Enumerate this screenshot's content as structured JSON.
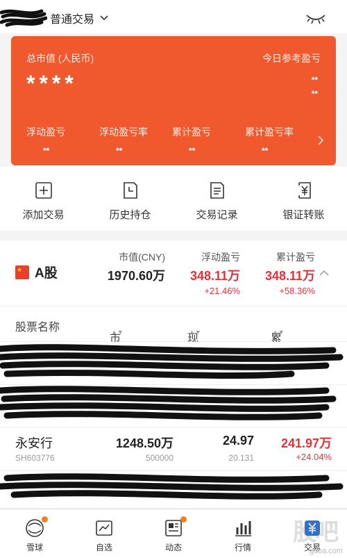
{
  "header": {
    "account_type": "普通交易"
  },
  "summary_card": {
    "total_label": "总市值 (人民币)",
    "total_value": "****",
    "today_label": "今日参考盈亏",
    "today_value_1": "**",
    "today_value_2": "**",
    "metrics": [
      {
        "label": "浮动盈亏",
        "value": "**"
      },
      {
        "label": "浮动盈亏率",
        "value": "**"
      },
      {
        "label": "累计盈亏",
        "value": "**"
      },
      {
        "label": "累计盈亏率",
        "value": "**"
      }
    ],
    "color": "#f0592d"
  },
  "quick_actions": [
    {
      "label": "添加交易",
      "icon": "plus-square-icon"
    },
    {
      "label": "历史持仓",
      "icon": "history-doc-icon"
    },
    {
      "label": "交易记录",
      "icon": "record-list-icon"
    },
    {
      "label": "银证转账",
      "icon": "yuan-transfer-icon"
    }
  ],
  "holdings_header": {
    "market": "A股",
    "market_value_label": "市值(CNY)",
    "market_value": "1970.60万",
    "float_pl_label": "浮动盈亏",
    "float_pl": "348.11万",
    "float_pl_pct": "+21.46%",
    "cum_pl_label": "累计盈亏",
    "cum_pl": "348.11万",
    "cum_pl_pct": "+58.36%"
  },
  "columns": {
    "name": "股票名称",
    "mv_qty": "市值/数量",
    "price_cost": "现价/成本",
    "cum_pl": "累计盈亏"
  },
  "visible_row": {
    "name": "永安行",
    "code": "SH603776",
    "market_value": "1248.50万",
    "quantity": "500000",
    "price": "24.97",
    "cost": "20.131",
    "cum_pl": "241.97万",
    "cum_pl_pct": "+24.04%"
  },
  "tabs": [
    {
      "label": "雪球",
      "icon": "snowball-icon",
      "dot": true
    },
    {
      "label": "自选",
      "icon": "watchlist-chart-icon",
      "dot": false
    },
    {
      "label": "动态",
      "icon": "feed-icon",
      "dot": true
    },
    {
      "label": "行情",
      "icon": "market-bars-icon",
      "dot": false
    },
    {
      "label": "交易",
      "icon": "trade-yuan-icon",
      "dot": false
    }
  ],
  "watermark": "guba.com"
}
